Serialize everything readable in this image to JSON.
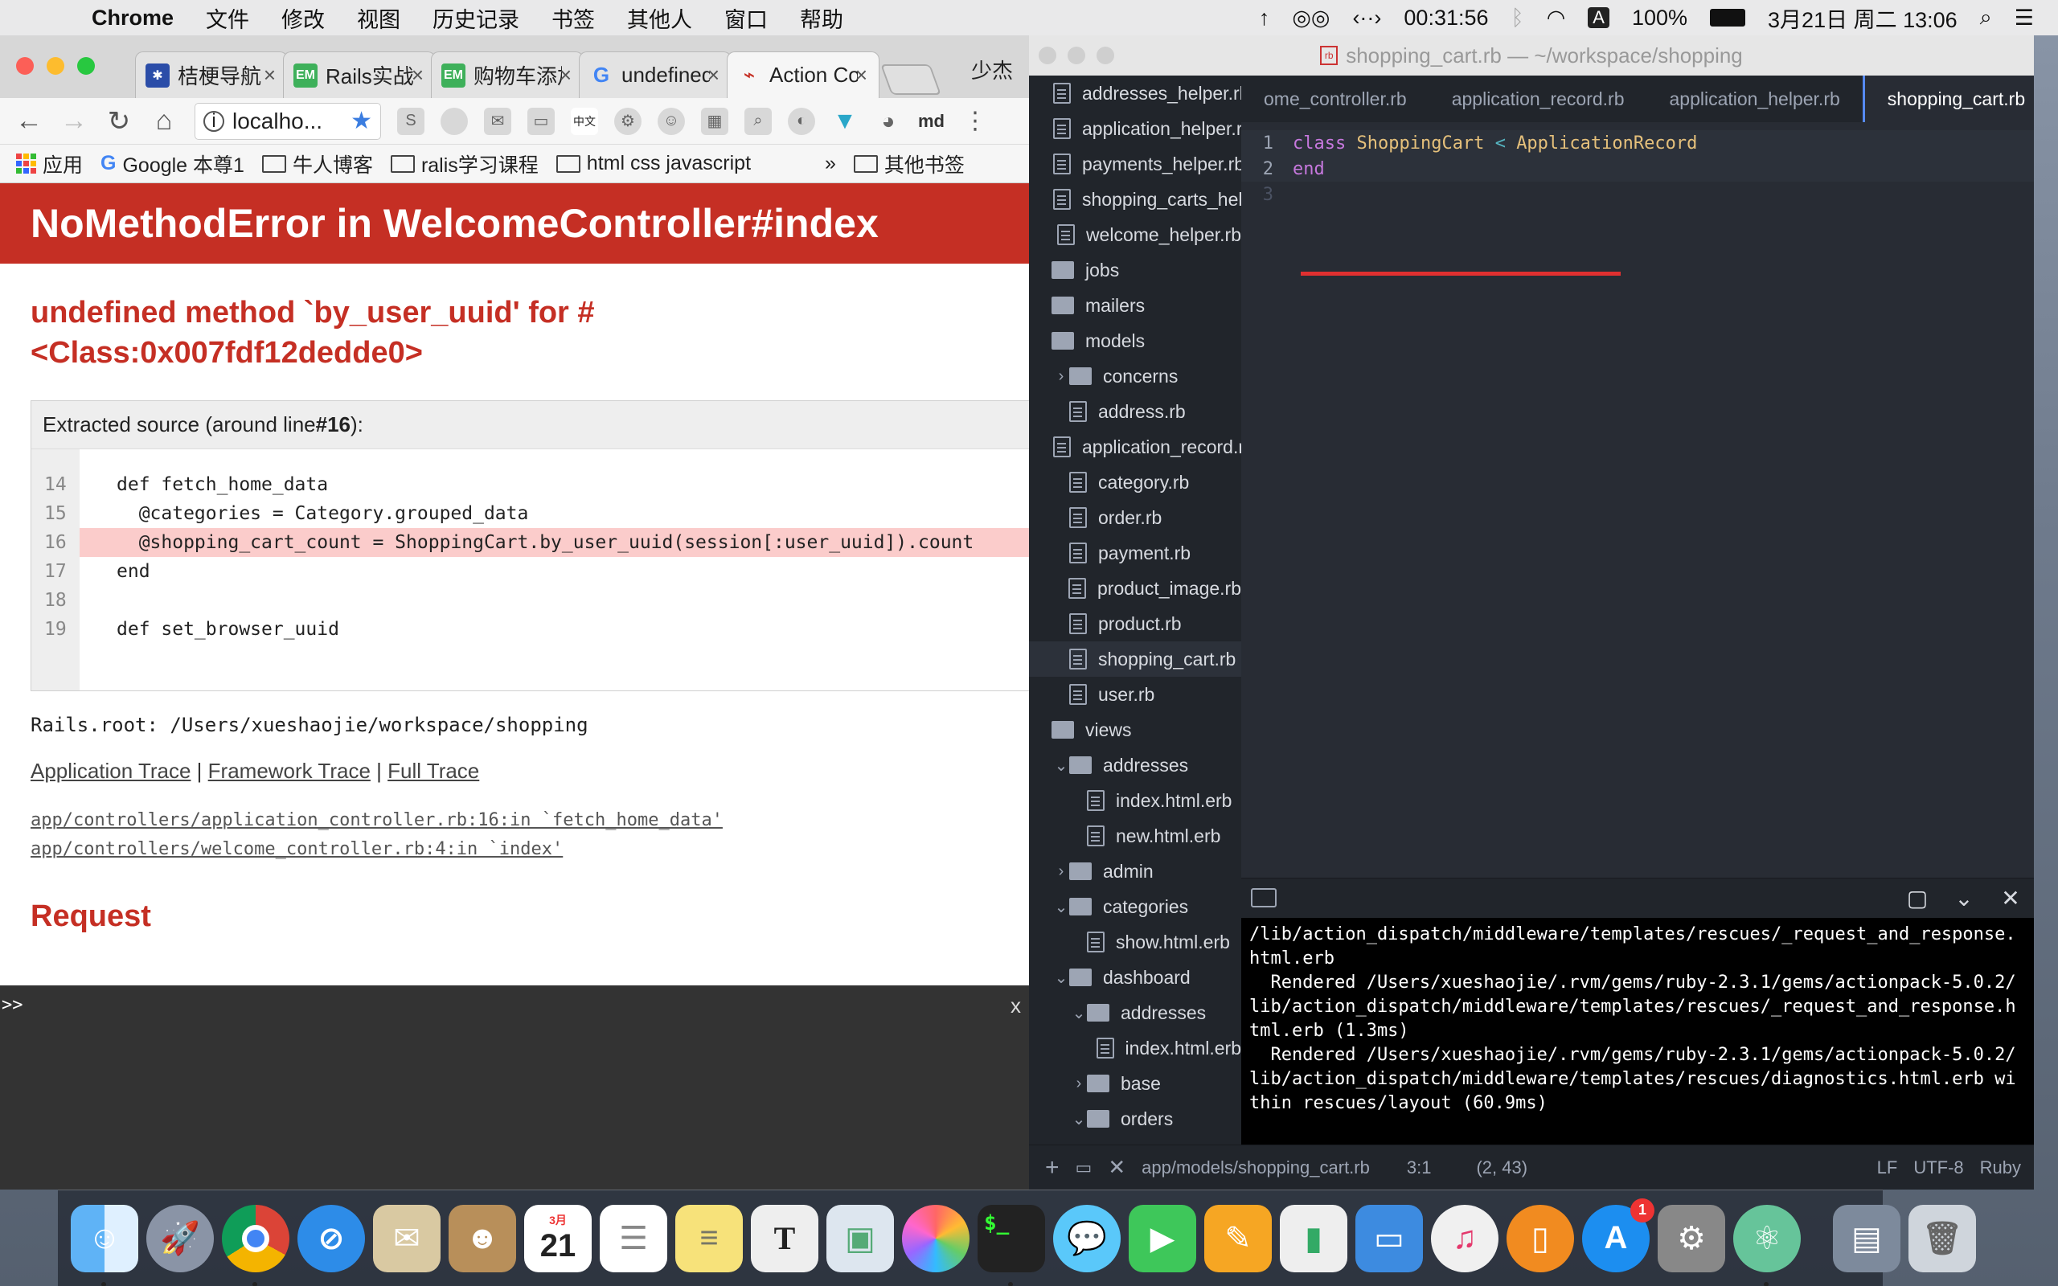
{
  "menubar": {
    "app_name": "Chrome",
    "items": [
      "文件",
      "修改",
      "视图",
      "历史记录",
      "书签",
      "其他人",
      "窗口",
      "帮助"
    ],
    "clock": "00:31:56",
    "battery": "100%",
    "datetime": "3月21日 周二 13:06",
    "input_indicator": "A"
  },
  "chrome": {
    "tabs": [
      {
        "label": "桔梗导航",
        "favicon": "star-compass-icon",
        "color": "#2b4da8"
      },
      {
        "label": "Rails实战",
        "favicon": "em-icon",
        "color": "#3eb05a"
      },
      {
        "label": "购物车添加",
        "favicon": "em-icon",
        "color": "#3eb05a"
      },
      {
        "label": "undefined",
        "favicon": "google-icon",
        "color": "#ffffff"
      },
      {
        "label": "Action Controller",
        "favicon": "rails-icon",
        "color": "#ffffff"
      }
    ],
    "em_favicon_text": "EM",
    "profile": "少杰",
    "address": "localho...",
    "ext_md": "md",
    "bookmarks": [
      {
        "label": "应用",
        "icon": "apps-icon"
      },
      {
        "label": "Google 本尊1",
        "icon": "google-icon"
      },
      {
        "label": "牛人博客",
        "icon": "folder-icon"
      },
      {
        "label": "ralis学习课程",
        "icon": "folder-icon"
      },
      {
        "label": "html css javascript",
        "icon": "folder-icon"
      }
    ],
    "bookmarks_more": "»",
    "other_bookmarks": "其他书签"
  },
  "error_page": {
    "header": "NoMethodError in WelcomeController#index",
    "message_line1": "undefined method `by_user_uuid' for #",
    "message_line2": "<Class:0x007fdf12dedde0>",
    "source_prefix": "Extracted source (around line ",
    "source_line": "#16",
    "source_suffix": "):",
    "line_numbers": [
      "14",
      "15",
      "16",
      "17",
      "18",
      "19"
    ],
    "code_lines": [
      "def fetch_home_data",
      "  @categories = Category.grouped_data",
      "  @shopping_cart_count = ShoppingCart.by_user_uuid(session[:user_uuid]).count",
      "end",
      "",
      "def set_browser_uuid"
    ],
    "rails_root": "Rails.root: /Users/xueshaojie/workspace/shopping",
    "trace_links": [
      "Application Trace",
      "Framework Trace",
      "Full Trace"
    ],
    "trace_separator": " | ",
    "trace_lines": [
      "app/controllers/application_controller.rb:16:in `fetch_home_data'",
      "app/controllers/welcome_controller.rb:4:in `index'"
    ],
    "request_heading": "Request",
    "console_prompt": ">>",
    "console_close": "x"
  },
  "atom": {
    "window_title": "shopping_cart.rb — ~/workspace/shopping",
    "tree_items": [
      {
        "label": "addresses_helper.rb",
        "type": "file",
        "depth": 1
      },
      {
        "label": "application_helper.rb",
        "type": "file",
        "depth": 1
      },
      {
        "label": "payments_helper.rb",
        "type": "file",
        "depth": 1
      },
      {
        "label": "shopping_carts_helper.rb",
        "type": "file",
        "depth": 1
      },
      {
        "label": "welcome_helper.rb",
        "type": "file",
        "depth": 1
      },
      {
        "label": "jobs",
        "type": "dir",
        "depth": 0,
        "arrow": ""
      },
      {
        "label": "mailers",
        "type": "dir",
        "depth": 0,
        "arrow": ""
      },
      {
        "label": "models",
        "type": "dir",
        "depth": 0,
        "arrow": ""
      },
      {
        "label": "concerns",
        "type": "dir",
        "depth": 1,
        "arrow": "›"
      },
      {
        "label": "address.rb",
        "type": "file",
        "depth": 1
      },
      {
        "label": "application_record.rb",
        "type": "file",
        "depth": 1
      },
      {
        "label": "category.rb",
        "type": "file",
        "depth": 1
      },
      {
        "label": "order.rb",
        "type": "file",
        "depth": 1
      },
      {
        "label": "payment.rb",
        "type": "file",
        "depth": 1
      },
      {
        "label": "product_image.rb",
        "type": "file",
        "depth": 1
      },
      {
        "label": "product.rb",
        "type": "file",
        "depth": 1
      },
      {
        "label": "shopping_cart.rb",
        "type": "file",
        "depth": 1,
        "selected": true
      },
      {
        "label": "user.rb",
        "type": "file",
        "depth": 1
      },
      {
        "label": "views",
        "type": "dir",
        "depth": 0,
        "arrow": ""
      },
      {
        "label": "addresses",
        "type": "dir",
        "depth": 1,
        "arrow": "⌄"
      },
      {
        "label": "index.html.erb",
        "type": "file",
        "depth": 2
      },
      {
        "label": "new.html.erb",
        "type": "file",
        "depth": 2
      },
      {
        "label": "admin",
        "type": "dir",
        "depth": 1,
        "arrow": "›"
      },
      {
        "label": "categories",
        "type": "dir",
        "depth": 1,
        "arrow": "⌄"
      },
      {
        "label": "show.html.erb",
        "type": "file",
        "depth": 2
      },
      {
        "label": "dashboard",
        "type": "dir",
        "depth": 1,
        "arrow": "⌄"
      },
      {
        "label": "addresses",
        "type": "dir",
        "depth": 2,
        "arrow": "⌄"
      },
      {
        "label": "index.html.erb",
        "type": "file",
        "depth": 3
      },
      {
        "label": "base",
        "type": "dir",
        "depth": 2,
        "arrow": "›"
      },
      {
        "label": "orders",
        "type": "dir",
        "depth": 2,
        "arrow": "⌄"
      }
    ],
    "editor_tabs": [
      "ome_controller.rb",
      "application_record.rb",
      "application_helper.rb",
      "shopping_cart.rb"
    ],
    "code": {
      "line1_kw": "class",
      "line1_cls": "ShoppingCart",
      "line1_op": "<",
      "line1_parent": "ApplicationRecord",
      "line2_kw": "end",
      "line_numbers": [
        "1",
        "2",
        "3"
      ]
    },
    "terminal_text": "/lib/action_dispatch/middleware/templates/rescues/_request_and_response.\nhtml.erb\n  Rendered /Users/xueshaojie/.rvm/gems/ruby-2.3.1/gems/actionpack-5.0.2/\nlib/action_dispatch/middleware/templates/rescues/_request_and_response.h\ntml.erb (1.3ms)\n  Rendered /Users/xueshaojie/.rvm/gems/ruby-2.3.1/gems/actionpack-5.0.2/\nlib/action_dispatch/middleware/templates/rescues/diagnostics.html.erb wi\nthin rescues/layout (60.9ms)",
    "status": {
      "path": "app/models/shopping_cart.rb",
      "cursor": "3:1",
      "selection": "(2, 43)",
      "line_ending": "LF",
      "encoding": "UTF-8",
      "grammar": "Ruby"
    }
  },
  "dock": {
    "calendar_month": "3月",
    "calendar_day": "21",
    "appstore_badge": "1",
    "terminal_glyph": "$_",
    "textedit_glyph": "T"
  }
}
